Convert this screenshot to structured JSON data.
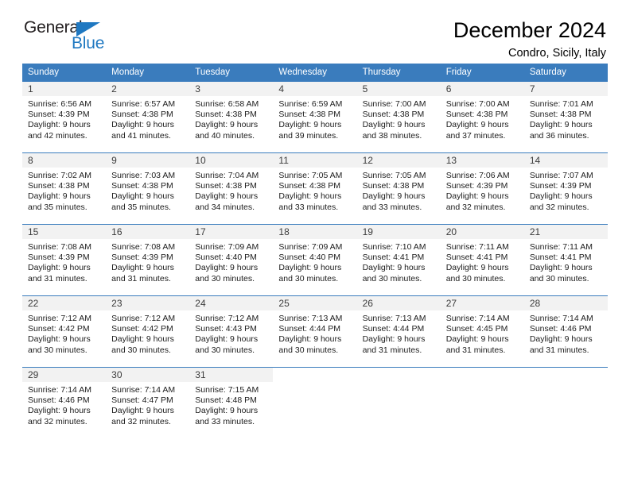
{
  "brand": {
    "name_top": "General",
    "name_bottom": "Blue",
    "accent_color": "#1f78c1",
    "triangle_icon": "triangle-icon"
  },
  "header": {
    "title": "December 2024",
    "location": "Condro, Sicily, Italy"
  },
  "colors": {
    "header_blue": "#3a7cbd",
    "daynum_bg": "#f2f2f2",
    "text": "#1c1c1c"
  },
  "weekdays": [
    "Sunday",
    "Monday",
    "Tuesday",
    "Wednesday",
    "Thursday",
    "Friday",
    "Saturday"
  ],
  "weeks": [
    [
      {
        "day": "1",
        "sunrise": "Sunrise: 6:56 AM",
        "sunset": "Sunset: 4:39 PM",
        "daylight1": "Daylight: 9 hours",
        "daylight2": "and 42 minutes."
      },
      {
        "day": "2",
        "sunrise": "Sunrise: 6:57 AM",
        "sunset": "Sunset: 4:38 PM",
        "daylight1": "Daylight: 9 hours",
        "daylight2": "and 41 minutes."
      },
      {
        "day": "3",
        "sunrise": "Sunrise: 6:58 AM",
        "sunset": "Sunset: 4:38 PM",
        "daylight1": "Daylight: 9 hours",
        "daylight2": "and 40 minutes."
      },
      {
        "day": "4",
        "sunrise": "Sunrise: 6:59 AM",
        "sunset": "Sunset: 4:38 PM",
        "daylight1": "Daylight: 9 hours",
        "daylight2": "and 39 minutes."
      },
      {
        "day": "5",
        "sunrise": "Sunrise: 7:00 AM",
        "sunset": "Sunset: 4:38 PM",
        "daylight1": "Daylight: 9 hours",
        "daylight2": "and 38 minutes."
      },
      {
        "day": "6",
        "sunrise": "Sunrise: 7:00 AM",
        "sunset": "Sunset: 4:38 PM",
        "daylight1": "Daylight: 9 hours",
        "daylight2": "and 37 minutes."
      },
      {
        "day": "7",
        "sunrise": "Sunrise: 7:01 AM",
        "sunset": "Sunset: 4:38 PM",
        "daylight1": "Daylight: 9 hours",
        "daylight2": "and 36 minutes."
      }
    ],
    [
      {
        "day": "8",
        "sunrise": "Sunrise: 7:02 AM",
        "sunset": "Sunset: 4:38 PM",
        "daylight1": "Daylight: 9 hours",
        "daylight2": "and 35 minutes."
      },
      {
        "day": "9",
        "sunrise": "Sunrise: 7:03 AM",
        "sunset": "Sunset: 4:38 PM",
        "daylight1": "Daylight: 9 hours",
        "daylight2": "and 35 minutes."
      },
      {
        "day": "10",
        "sunrise": "Sunrise: 7:04 AM",
        "sunset": "Sunset: 4:38 PM",
        "daylight1": "Daylight: 9 hours",
        "daylight2": "and 34 minutes."
      },
      {
        "day": "11",
        "sunrise": "Sunrise: 7:05 AM",
        "sunset": "Sunset: 4:38 PM",
        "daylight1": "Daylight: 9 hours",
        "daylight2": "and 33 minutes."
      },
      {
        "day": "12",
        "sunrise": "Sunrise: 7:05 AM",
        "sunset": "Sunset: 4:38 PM",
        "daylight1": "Daylight: 9 hours",
        "daylight2": "and 33 minutes."
      },
      {
        "day": "13",
        "sunrise": "Sunrise: 7:06 AM",
        "sunset": "Sunset: 4:39 PM",
        "daylight1": "Daylight: 9 hours",
        "daylight2": "and 32 minutes."
      },
      {
        "day": "14",
        "sunrise": "Sunrise: 7:07 AM",
        "sunset": "Sunset: 4:39 PM",
        "daylight1": "Daylight: 9 hours",
        "daylight2": "and 32 minutes."
      }
    ],
    [
      {
        "day": "15",
        "sunrise": "Sunrise: 7:08 AM",
        "sunset": "Sunset: 4:39 PM",
        "daylight1": "Daylight: 9 hours",
        "daylight2": "and 31 minutes."
      },
      {
        "day": "16",
        "sunrise": "Sunrise: 7:08 AM",
        "sunset": "Sunset: 4:39 PM",
        "daylight1": "Daylight: 9 hours",
        "daylight2": "and 31 minutes."
      },
      {
        "day": "17",
        "sunrise": "Sunrise: 7:09 AM",
        "sunset": "Sunset: 4:40 PM",
        "daylight1": "Daylight: 9 hours",
        "daylight2": "and 30 minutes."
      },
      {
        "day": "18",
        "sunrise": "Sunrise: 7:09 AM",
        "sunset": "Sunset: 4:40 PM",
        "daylight1": "Daylight: 9 hours",
        "daylight2": "and 30 minutes."
      },
      {
        "day": "19",
        "sunrise": "Sunrise: 7:10 AM",
        "sunset": "Sunset: 4:41 PM",
        "daylight1": "Daylight: 9 hours",
        "daylight2": "and 30 minutes."
      },
      {
        "day": "20",
        "sunrise": "Sunrise: 7:11 AM",
        "sunset": "Sunset: 4:41 PM",
        "daylight1": "Daylight: 9 hours",
        "daylight2": "and 30 minutes."
      },
      {
        "day": "21",
        "sunrise": "Sunrise: 7:11 AM",
        "sunset": "Sunset: 4:41 PM",
        "daylight1": "Daylight: 9 hours",
        "daylight2": "and 30 minutes."
      }
    ],
    [
      {
        "day": "22",
        "sunrise": "Sunrise: 7:12 AM",
        "sunset": "Sunset: 4:42 PM",
        "daylight1": "Daylight: 9 hours",
        "daylight2": "and 30 minutes."
      },
      {
        "day": "23",
        "sunrise": "Sunrise: 7:12 AM",
        "sunset": "Sunset: 4:42 PM",
        "daylight1": "Daylight: 9 hours",
        "daylight2": "and 30 minutes."
      },
      {
        "day": "24",
        "sunrise": "Sunrise: 7:12 AM",
        "sunset": "Sunset: 4:43 PM",
        "daylight1": "Daylight: 9 hours",
        "daylight2": "and 30 minutes."
      },
      {
        "day": "25",
        "sunrise": "Sunrise: 7:13 AM",
        "sunset": "Sunset: 4:44 PM",
        "daylight1": "Daylight: 9 hours",
        "daylight2": "and 30 minutes."
      },
      {
        "day": "26",
        "sunrise": "Sunrise: 7:13 AM",
        "sunset": "Sunset: 4:44 PM",
        "daylight1": "Daylight: 9 hours",
        "daylight2": "and 31 minutes."
      },
      {
        "day": "27",
        "sunrise": "Sunrise: 7:14 AM",
        "sunset": "Sunset: 4:45 PM",
        "daylight1": "Daylight: 9 hours",
        "daylight2": "and 31 minutes."
      },
      {
        "day": "28",
        "sunrise": "Sunrise: 7:14 AM",
        "sunset": "Sunset: 4:46 PM",
        "daylight1": "Daylight: 9 hours",
        "daylight2": "and 31 minutes."
      }
    ],
    [
      {
        "day": "29",
        "sunrise": "Sunrise: 7:14 AM",
        "sunset": "Sunset: 4:46 PM",
        "daylight1": "Daylight: 9 hours",
        "daylight2": "and 32 minutes."
      },
      {
        "day": "30",
        "sunrise": "Sunrise: 7:14 AM",
        "sunset": "Sunset: 4:47 PM",
        "daylight1": "Daylight: 9 hours",
        "daylight2": "and 32 minutes."
      },
      {
        "day": "31",
        "sunrise": "Sunrise: 7:15 AM",
        "sunset": "Sunset: 4:48 PM",
        "daylight1": "Daylight: 9 hours",
        "daylight2": "and 33 minutes."
      },
      {
        "day": "",
        "sunrise": "",
        "sunset": "",
        "daylight1": "",
        "daylight2": ""
      },
      {
        "day": "",
        "sunrise": "",
        "sunset": "",
        "daylight1": "",
        "daylight2": ""
      },
      {
        "day": "",
        "sunrise": "",
        "sunset": "",
        "daylight1": "",
        "daylight2": ""
      },
      {
        "day": "",
        "sunrise": "",
        "sunset": "",
        "daylight1": "",
        "daylight2": ""
      }
    ]
  ]
}
